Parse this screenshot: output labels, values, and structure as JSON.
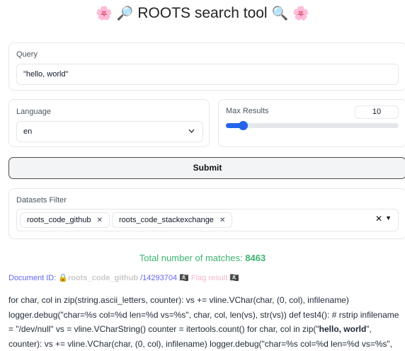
{
  "header": {
    "title": "ROOTS search tool",
    "left_icons": [
      "🌸",
      "🔎"
    ],
    "right_icons": [
      "🔍",
      "🌸"
    ]
  },
  "query": {
    "label": "Query",
    "value": "\"hello, world\""
  },
  "language": {
    "label": "Language",
    "selected": "en"
  },
  "max_results": {
    "label": "Max Results",
    "value": "10",
    "level": 0.1
  },
  "submit": {
    "label": "Submit"
  },
  "datasets_filter": {
    "label": "Datasets Filter",
    "chips": [
      "roots_code_github",
      "roots_code_stackexchange"
    ]
  },
  "results": {
    "matches_label": "Total number of matches:",
    "matches_count": "8463",
    "doc": {
      "label": "Document ID:",
      "lock_icon": "🔒",
      "dataset": "roots_code_github",
      "number": "/14293704",
      "pirate_icon": "🏴‍☠️",
      "flag_label": "Flag result"
    },
    "lines": [
      [
        "for char, col in zip(string.ascii_letters, counter): vs += vline.VChar(char, (0, col), infilename)",
        ""
      ],
      [
        "logger.debug(\"char=%s col=%d len=%d vs=%s\", char, col, len(vs), str(vs)) def test4(): # rstrip infilename",
        ""
      ],
      [
        "= \"/dev/null\" vs = vline.VCharString() counter = itertools.count() for char, col in zip(\"",
        "hello, world",
        "\","
      ],
      [
        "counter): vs += vline.VChar(char, (0, col), infilename) logger.debug(\"char=%s col=%d len=%d vs=%s\",",
        ""
      ]
    ]
  },
  "colors": {
    "accent": "#2563eb",
    "matches": "#3cb371",
    "doc_link": "#6366f1",
    "flag": "#f5b8cf"
  }
}
